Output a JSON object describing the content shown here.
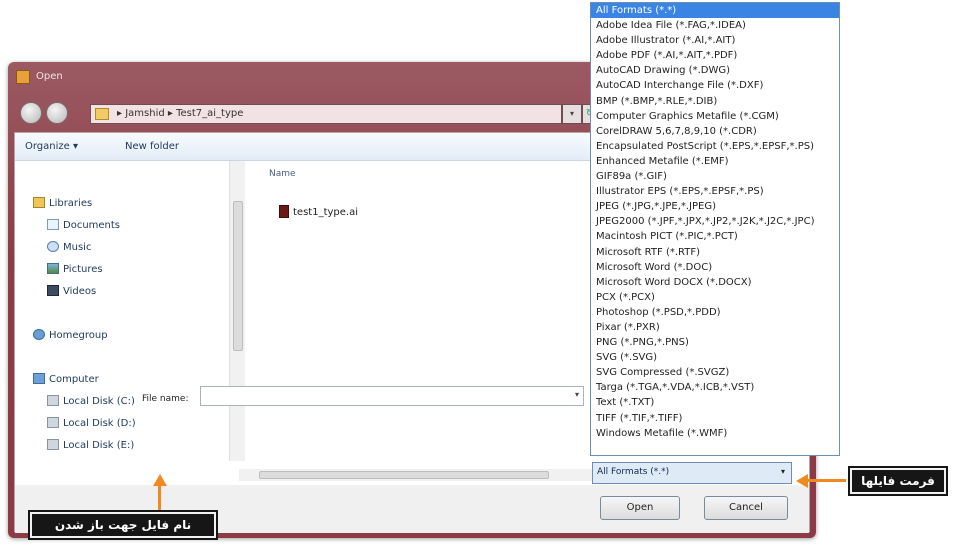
{
  "window": {
    "title": "Open"
  },
  "address": {
    "path": "▸ Jamshid ▸ Test7_ai_type"
  },
  "toolbar": {
    "organize": "Organize ▾",
    "new_folder": "New folder"
  },
  "nav": {
    "libraries": "Libraries",
    "documents": "Documents",
    "music": "Music",
    "pictures": "Pictures",
    "videos": "Videos",
    "homegroup": "Homegroup",
    "computer": "Computer",
    "disk_c": "Local Disk (C:)",
    "disk_d": "Local Disk (D:)",
    "disk_e": "Local Disk (E:)"
  },
  "files": {
    "header": "Name",
    "items": [
      "test1_type.ai"
    ]
  },
  "filename": {
    "label": "File name:",
    "value": ""
  },
  "filetype": {
    "selected": "All Formats (*.*)"
  },
  "buttons": {
    "open": "Open",
    "cancel": "Cancel"
  },
  "dropdown": {
    "items": [
      "All Formats (*.*)",
      "Adobe Idea File (*.FAG,*.IDEA)",
      "Adobe Illustrator (*.AI,*.AIT)",
      "Adobe PDF (*.AI,*.AIT,*.PDF)",
      "AutoCAD Drawing (*.DWG)",
      "AutoCAD Interchange File (*.DXF)",
      "BMP (*.BMP,*.RLE,*.DIB)",
      "Computer Graphics Metafile (*.CGM)",
      "CorelDRAW 5,6,7,8,9,10 (*.CDR)",
      "Encapsulated PostScript (*.EPS,*.EPSF,*.PS)",
      "Enhanced Metafile (*.EMF)",
      "GIF89a (*.GIF)",
      "Illustrator EPS (*.EPS,*.EPSF,*.PS)",
      "JPEG (*.JPG,*.JPE,*.JPEG)",
      "JPEG2000 (*.JPF,*.JPX,*.JP2,*.J2K,*.J2C,*.JPC)",
      "Macintosh PICT (*.PIC,*.PCT)",
      "Microsoft RTF (*.RTF)",
      "Microsoft Word (*.DOC)",
      "Microsoft Word DOCX (*.DOCX)",
      "PCX (*.PCX)",
      "Photoshop (*.PSD,*.PDD)",
      "Pixar (*.PXR)",
      "PNG (*.PNG,*.PNS)",
      "SVG (*.SVG)",
      "SVG Compressed (*.SVGZ)",
      "Targa (*.TGA,*.VDA,*.ICB,*.VST)",
      "Text (*.TXT)",
      "TIFF (*.TIF,*.TIFF)",
      "Windows Metafile (*.WMF)"
    ]
  },
  "callouts": {
    "file_format": "فرمت فایلها",
    "file_name": "نام فایل جهت باز شدن"
  },
  "colors": {
    "window_frame": "#8c3a44",
    "selection": "#3a84e4",
    "callout_bg": "#161616",
    "arrow": "#f08a20"
  }
}
